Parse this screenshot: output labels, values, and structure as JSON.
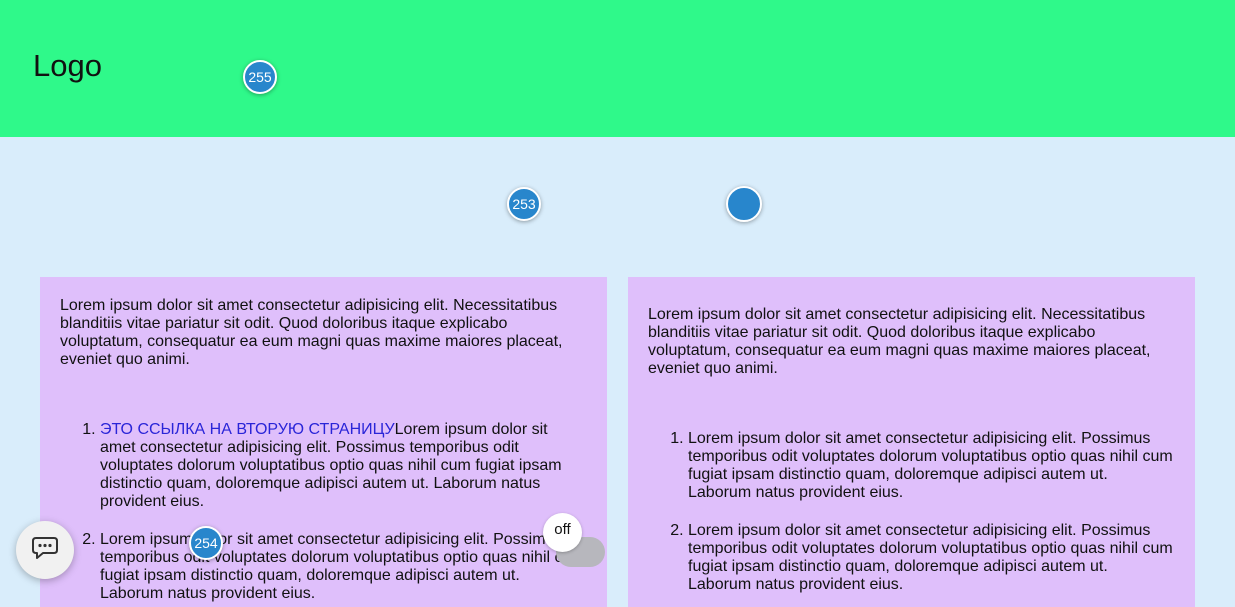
{
  "header": {
    "logo": "Logo",
    "background": "#2ff98a"
  },
  "markers": {
    "m255": "255",
    "m253": "253",
    "m254": "254",
    "blank": "",
    "color": "#2886cc"
  },
  "cards": {
    "left": {
      "intro": "Lorem ipsum dolor sit amet consectetur adipisicing elit. Necessitatibus blanditiis vitae pariatur sit odit. Quod doloribus itaque explicabo voluptatum, consequatur ea eum magni quas maxime maiores placeat, eveniet quo animi.",
      "items": [
        {
          "link": "ЭТО ССЫЛКА НА ВТОРУЮ СТРАНИЦУ",
          "text": "Lorem ipsum dolor sit amet consectetur adipisicing elit. Possimus temporibus odit voluptates dolorum voluptatibus optio quas nihil cum fugiat ipsam distinctio quam, doloremque adipisci autem ut. Laborum natus provident eius."
        },
        {
          "text": "Lorem ipsum dolor sit amet consectetur adipisicing elit. Possimus temporibus odit voluptates dolorum voluptatibus optio quas nihil cum fugiat ipsam distinctio quam, doloremque adipisci autem ut. Laborum natus provident eius."
        }
      ]
    },
    "right": {
      "intro": "Lorem ipsum dolor sit amet consectetur adipisicing elit. Necessitatibus blanditiis vitae pariatur sit odit. Quod doloribus itaque explicabo voluptatum, consequatur ea eum magni quas maxime maiores placeat, eveniet quo animi.",
      "items": [
        {
          "text": "Lorem ipsum dolor sit amet consectetur adipisicing elit. Possimus temporibus odit voluptates dolorum voluptatibus optio quas nihil cum fugiat ipsam distinctio quam, doloremque adipisci autem ut. Laborum natus provident eius."
        },
        {
          "text": "Lorem ipsum dolor sit amet consectetur adipisicing elit. Possimus temporibus odit voluptates dolorum voluptatibus optio quas nihil cum fugiat ipsam distinctio quam, doloremque adipisci autem ut. Laborum natus provident eius."
        }
      ]
    }
  },
  "chat": {
    "icon": "chat-bubble-icon"
  },
  "toggle": {
    "label": "off",
    "state": "off"
  }
}
